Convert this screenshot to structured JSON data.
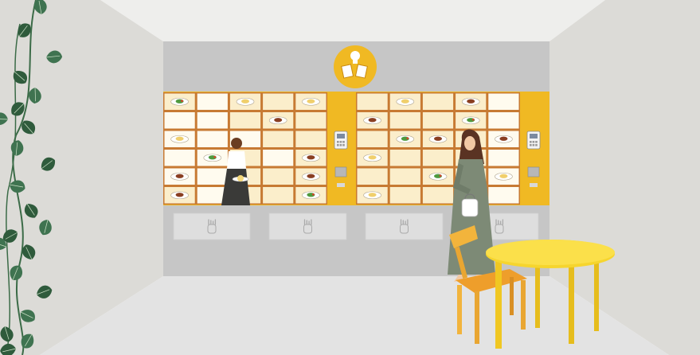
{
  "scene": {
    "kind": "illustration",
    "colors": {
      "wall": "#dcdbd7",
      "ceiling": "#eeeeec",
      "floor": "#e2e2e2",
      "back_wall": "#c6c6c6",
      "accent": "#f0b923",
      "locker_frame": "#c77a33",
      "locker_fill": "#fbeecb",
      "locker_empty": "#fffbef",
      "table": "#f5d22d",
      "chair": "#f2b43c",
      "plant": "#2f5b3c"
    },
    "icons": [
      "chef-logo-icon",
      "payment-terminal-icon",
      "hand-sensor-icon",
      "plant-icon",
      "dish-icon"
    ],
    "locker_grid": {
      "banks": 2,
      "rows": 6,
      "cols": 5
    }
  }
}
